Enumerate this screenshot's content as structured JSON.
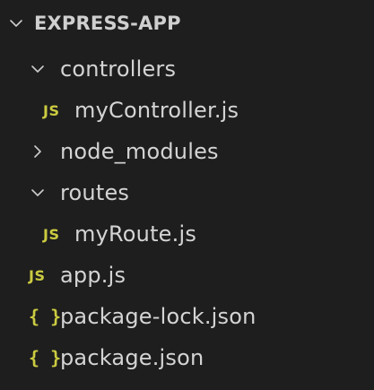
{
  "explorer": {
    "root": {
      "label": "EXPRESS-APP",
      "expanded": true,
      "icon": "chevron-down-icon"
    },
    "items": [
      {
        "label": "controllers",
        "type": "folder",
        "expanded": true,
        "icon": "chevron-down-icon"
      },
      {
        "label": "myController.js",
        "type": "file",
        "file_icon": "JS",
        "icon_color": "#cbcb41"
      },
      {
        "label": "node_modules",
        "type": "folder",
        "expanded": false,
        "icon": "chevron-right-icon"
      },
      {
        "label": "routes",
        "type": "folder",
        "expanded": true,
        "icon": "chevron-down-icon"
      },
      {
        "label": "myRoute.js",
        "type": "file",
        "file_icon": "JS",
        "icon_color": "#cbcb41"
      },
      {
        "label": "app.js",
        "type": "file",
        "file_icon": "JS",
        "icon_color": "#cbcb41"
      },
      {
        "label": "package-lock.json",
        "type": "file",
        "file_icon": "{ }",
        "icon_color": "#cbcb41"
      },
      {
        "label": "package.json",
        "type": "file",
        "file_icon": "{ }",
        "icon_color": "#cbcb41"
      }
    ]
  }
}
